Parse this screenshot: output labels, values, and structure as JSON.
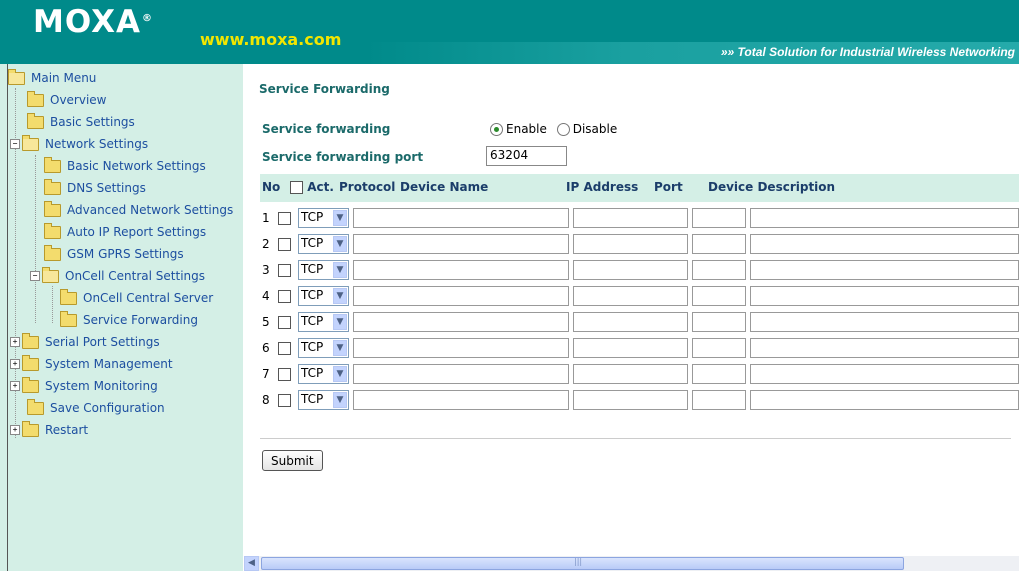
{
  "header": {
    "logo": "MOXA",
    "logo_mark": "®",
    "url": "www.moxa.com",
    "tagline": "»» Total Solution for Industrial Wireless Networking"
  },
  "sidebar": {
    "items": [
      {
        "label": "Main Menu"
      },
      {
        "label": "Overview"
      },
      {
        "label": "Basic Settings"
      },
      {
        "label": "Network Settings"
      },
      {
        "label": "Basic Network Settings"
      },
      {
        "label": "DNS Settings"
      },
      {
        "label": "Advanced Network Settings"
      },
      {
        "label": "Auto IP Report Settings"
      },
      {
        "label": "GSM GPRS Settings"
      },
      {
        "label": "OnCell Central Settings"
      },
      {
        "label": "OnCell Central Server"
      },
      {
        "label": "Service Forwarding"
      },
      {
        "label": "Serial Port Settings"
      },
      {
        "label": "System Management"
      },
      {
        "label": "System Monitoring"
      },
      {
        "label": "Save Configuration"
      },
      {
        "label": "Restart"
      }
    ]
  },
  "main": {
    "title": "Service Forwarding",
    "service_forwarding_label": "Service forwarding",
    "enable_label": "Enable",
    "disable_label": "Disable",
    "port_label": "Service forwarding port",
    "port_value": "63204",
    "table": {
      "headers": [
        "No",
        "Act.",
        "Protocol",
        "Device Name",
        "IP Address",
        "Port",
        "Device Description"
      ],
      "rows": [
        {
          "no": "1",
          "protocol": "TCP"
        },
        {
          "no": "2",
          "protocol": "TCP"
        },
        {
          "no": "3",
          "protocol": "TCP"
        },
        {
          "no": "4",
          "protocol": "TCP"
        },
        {
          "no": "5",
          "protocol": "TCP"
        },
        {
          "no": "6",
          "protocol": "TCP"
        },
        {
          "no": "7",
          "protocol": "TCP"
        },
        {
          "no": "8",
          "protocol": "TCP"
        }
      ]
    },
    "submit_label": "Submit"
  },
  "colors": {
    "header_bg": "#008a8a",
    "url_yellow": "#f2e600",
    "sidebar_bg": "#d4efe6",
    "label_color": "#1b6a6a",
    "tree_text": "#1d4fa0"
  }
}
